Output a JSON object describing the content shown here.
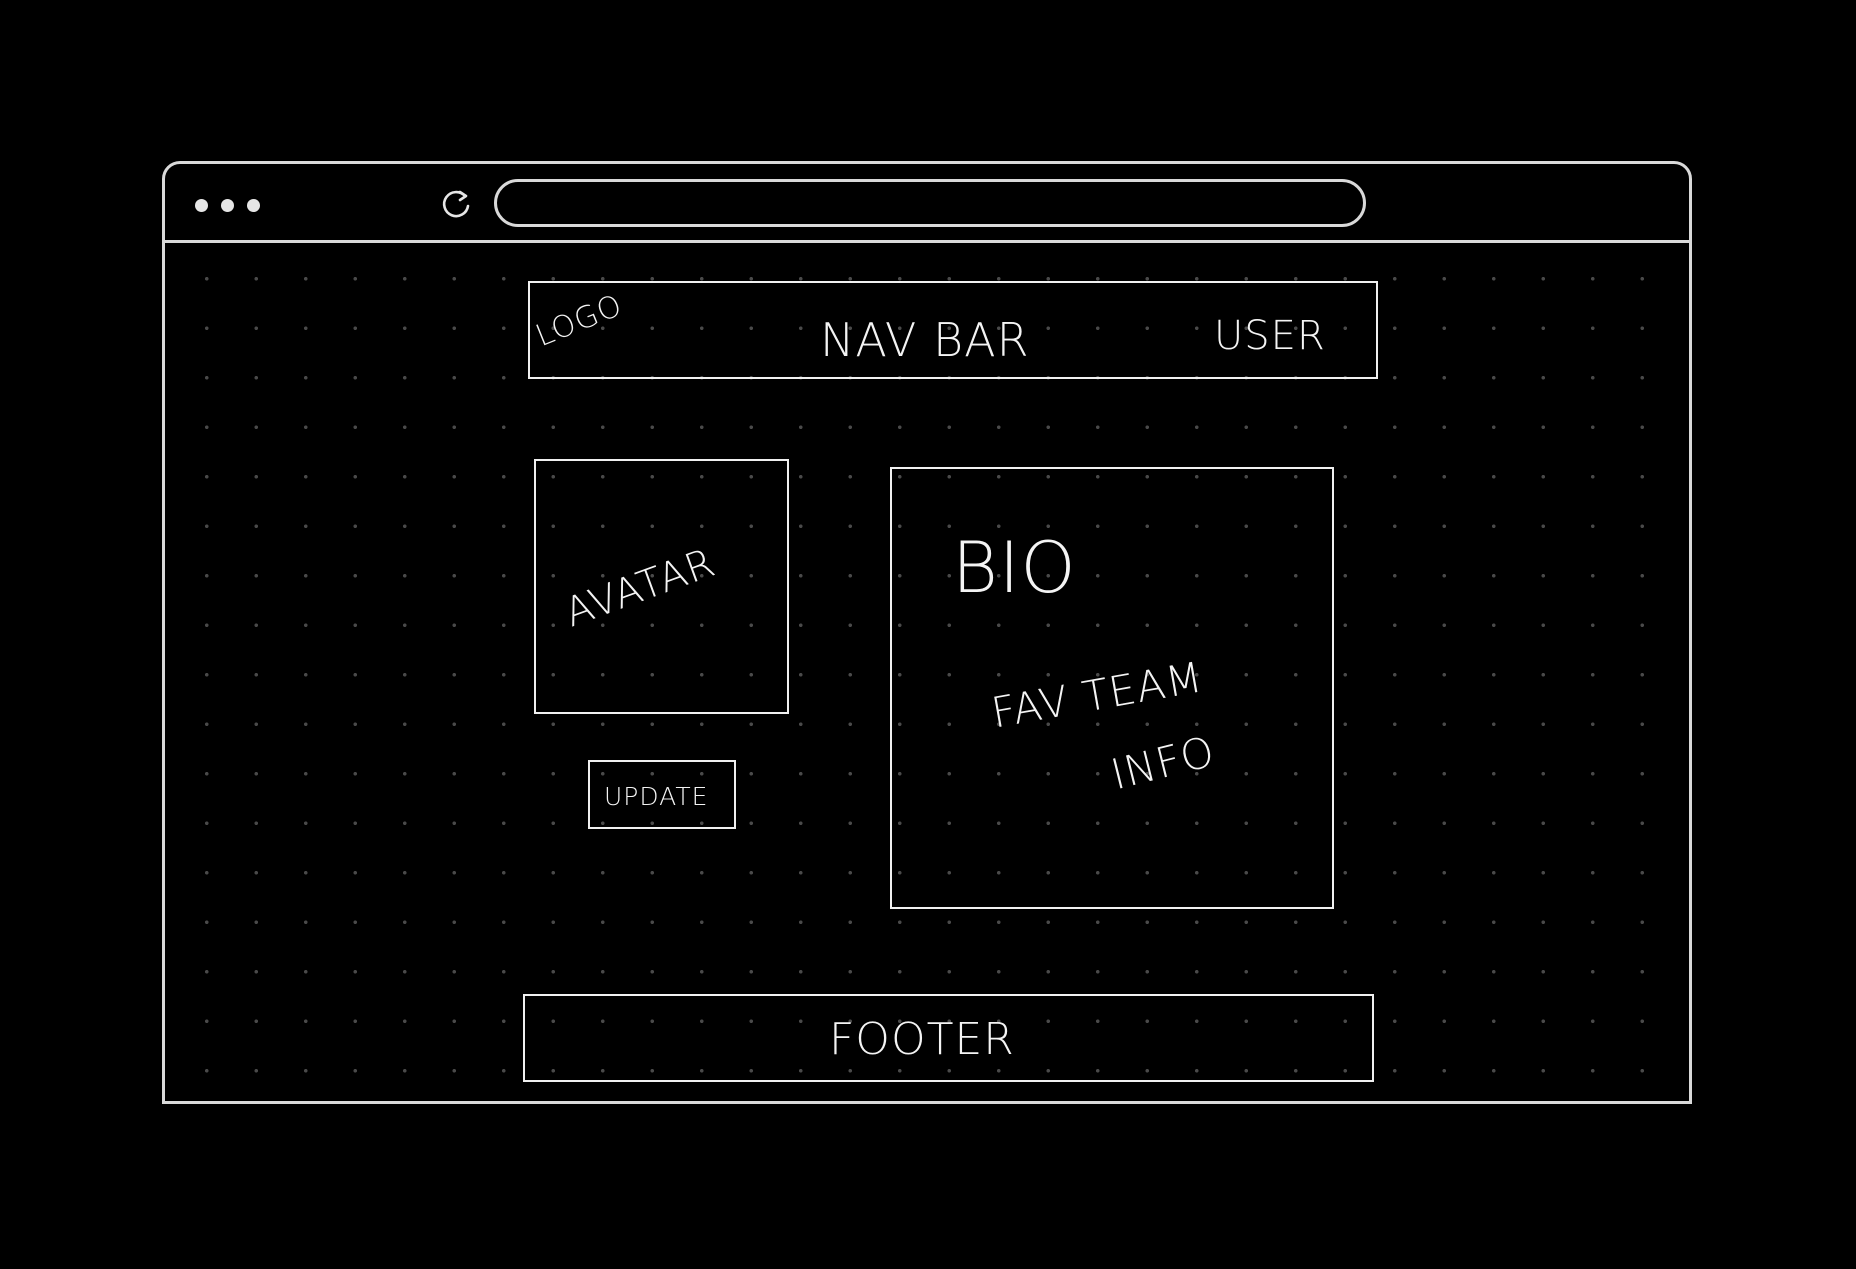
{
  "navbar": {
    "logo_label": "LOGO",
    "title_label": "NAV BAR",
    "user_label": "USER"
  },
  "avatar": {
    "label": "AVATAR"
  },
  "update_button": {
    "label": "UPDATE"
  },
  "bio": {
    "title": "BIO",
    "info_line1": "FAV TEAM",
    "info_line2": "INFO"
  },
  "footer": {
    "label": "FOOTER"
  },
  "colors": {
    "background": "#000000",
    "stroke": "#f0f0f0",
    "grid_dot": "#4a4a4a"
  }
}
